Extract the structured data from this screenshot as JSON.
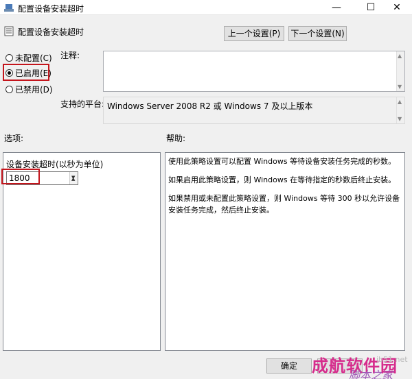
{
  "window": {
    "title": "配置设备安装超时",
    "controls": {
      "minimize": "—",
      "maximize": "☐",
      "close": "✕"
    }
  },
  "header": {
    "title": "配置设备安装超时",
    "prev_label": "上一个设置(P)",
    "next_label": "下一个设置(N)"
  },
  "state": {
    "options": [
      {
        "label": "未配置(C)",
        "checked": false
      },
      {
        "label": "已启用(E)",
        "checked": true
      },
      {
        "label": "已禁用(D)",
        "checked": false
      }
    ]
  },
  "labels": {
    "comment": "注释:",
    "platform": "支持的平台:",
    "options": "选项:",
    "help": "帮助:"
  },
  "platform_text": "Windows Server 2008 R2 或 Windows 7 及以上版本",
  "options_panel": {
    "timeout_label": "设备安装超时(以秒为单位)",
    "timeout_value": "1800"
  },
  "help": {
    "paragraphs": [
      "使用此策略设置可以配置 Windows 等待设备安装任务完成的秒数。",
      "如果启用此策略设置，则 Windows 在等待指定的秒数后终止安装。",
      "如果禁用或未配置此策略设置，则 Windows 等待 300 秒以允许设备安装任务完成，然后终止安装。"
    ]
  },
  "footer": {
    "ok_label": "确定",
    "cancel_label": ""
  },
  "watermark": {
    "main": "成航软件园",
    "sub": "脚本之家",
    "url": "jb51.net"
  }
}
